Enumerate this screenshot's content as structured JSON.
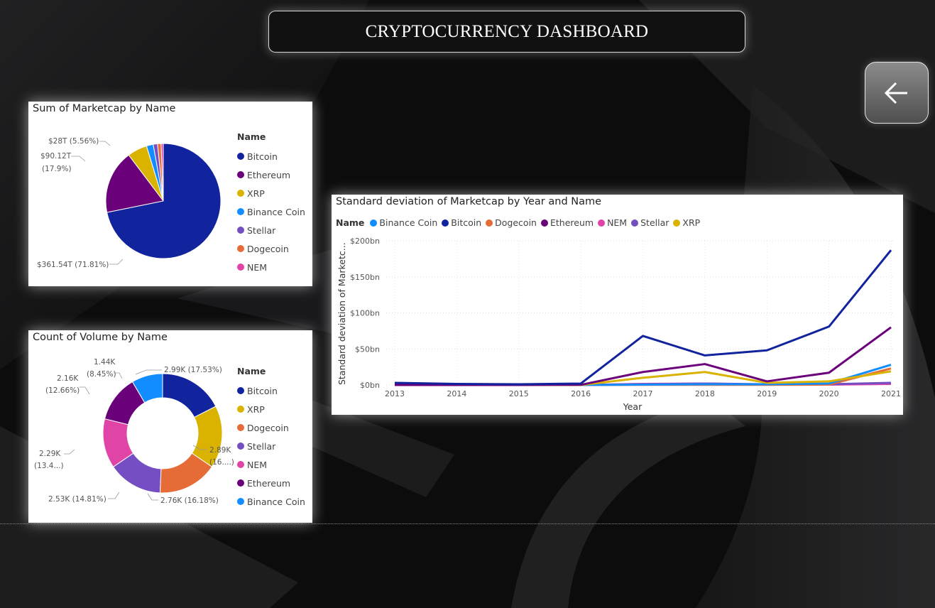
{
  "dashboard": {
    "title": "CRYPTOCURRENCY DASHBOARD"
  },
  "nav": {
    "back_icon": "arrow-left-icon"
  },
  "pie": {
    "title": "Sum of Marketcap by Name",
    "legend_title": "Name",
    "legend": [
      "Bitcoin",
      "Ethereum",
      "XRP",
      "Binance Coin",
      "Stellar",
      "Dogecoin",
      "NEM"
    ],
    "labels": {
      "xrp": "$28T (5.56%)",
      "eth_1": "$90.12T",
      "eth_2": "(17.9%)",
      "btc": "$361.54T (71.81%)"
    }
  },
  "donut": {
    "title": "Count of Volume by Name",
    "legend_title": "Name",
    "legend": [
      "Bitcoin",
      "XRP",
      "Dogecoin",
      "Stellar",
      "NEM",
      "Ethereum",
      "Binance Coin"
    ],
    "labels": {
      "btc": "2.99K (17.53%)",
      "xrp_1": "2.89K",
      "xrp_2": "(16....)",
      "doge": "2.76K (16.18%)",
      "stellar": "2.53K (14.81%)",
      "nem_1": "2.29K",
      "nem_2": "(13.4...)",
      "eth_1": "2.16K",
      "eth_2": "(12.66%)",
      "bnb_1": "1.44K",
      "bnb_2": "(8.45%)"
    }
  },
  "line": {
    "title": "Standard deviation of Marketcap by Year and Name",
    "legend_title": "Name",
    "legend": [
      "Binance Coin",
      "Bitcoin",
      "Dogecoin",
      "Ethereum",
      "NEM",
      "Stellar",
      "XRP"
    ],
    "y_axis_title": "Standard deviation of Marketc...",
    "x_axis_title": "Year",
    "y_ticks": [
      "$200bn",
      "$150bn",
      "$100bn",
      "$50bn",
      "$0bn"
    ],
    "x_ticks": [
      "2013",
      "2014",
      "2015",
      "2016",
      "2017",
      "2018",
      "2019",
      "2020",
      "2021"
    ]
  },
  "colors": {
    "Bitcoin": "#12239E",
    "Ethereum": "#6B007B",
    "XRP": "#D9B300",
    "Binance Coin": "#118DFF",
    "Stellar": "#744EC2",
    "Dogecoin": "#E66C37",
    "NEM": "#E044A7"
  },
  "chart_data": [
    {
      "type": "pie",
      "title": "Sum of Marketcap by Name",
      "categories": [
        "Bitcoin",
        "Ethereum",
        "XRP",
        "Binance Coin",
        "Stellar",
        "Dogecoin",
        "NEM"
      ],
      "values": [
        71.81,
        17.9,
        5.56,
        1.9,
        1.2,
        1.0,
        0.63
      ],
      "unit": "percent of total"
    },
    {
      "type": "pie",
      "title": "Count of Volume by Name",
      "categories": [
        "Bitcoin",
        "XRP",
        "Dogecoin",
        "Stellar",
        "NEM",
        "Ethereum",
        "Binance Coin"
      ],
      "values": [
        17.53,
        16.95,
        16.18,
        14.81,
        13.42,
        12.66,
        8.45
      ],
      "unit": "percent of total"
    },
    {
      "type": "line",
      "title": "Standard deviation of Marketcap by Year and Name",
      "x": [
        2013,
        2014,
        2015,
        2016,
        2017,
        2018,
        2019,
        2020,
        2021
      ],
      "ylim": [
        0,
        200
      ],
      "yunit": "bn",
      "series": [
        {
          "name": "Binance Coin",
          "values": [
            0,
            0,
            0,
            0,
            0.5,
            1,
            1,
            2,
            28
          ]
        },
        {
          "name": "Bitcoin",
          "values": [
            3,
            1.5,
            1,
            2,
            68,
            41,
            48,
            81,
            187
          ]
        },
        {
          "name": "Dogecoin",
          "values": [
            0,
            0,
            0,
            0,
            0.3,
            0.3,
            0.2,
            0.5,
            23
          ]
        },
        {
          "name": "Ethereum",
          "values": [
            0,
            0,
            0,
            0.2,
            18,
            29,
            5,
            17,
            80
          ]
        },
        {
          "name": "NEM",
          "values": [
            0,
            0,
            0,
            0,
            1.5,
            2,
            0.5,
            0.5,
            1.5
          ]
        },
        {
          "name": "Stellar",
          "values": [
            0,
            0,
            0,
            0,
            1,
            2,
            1,
            1,
            3
          ]
        },
        {
          "name": "XRP",
          "values": [
            0,
            0,
            0,
            0,
            10,
            18,
            3,
            5,
            19
          ]
        }
      ]
    }
  ]
}
